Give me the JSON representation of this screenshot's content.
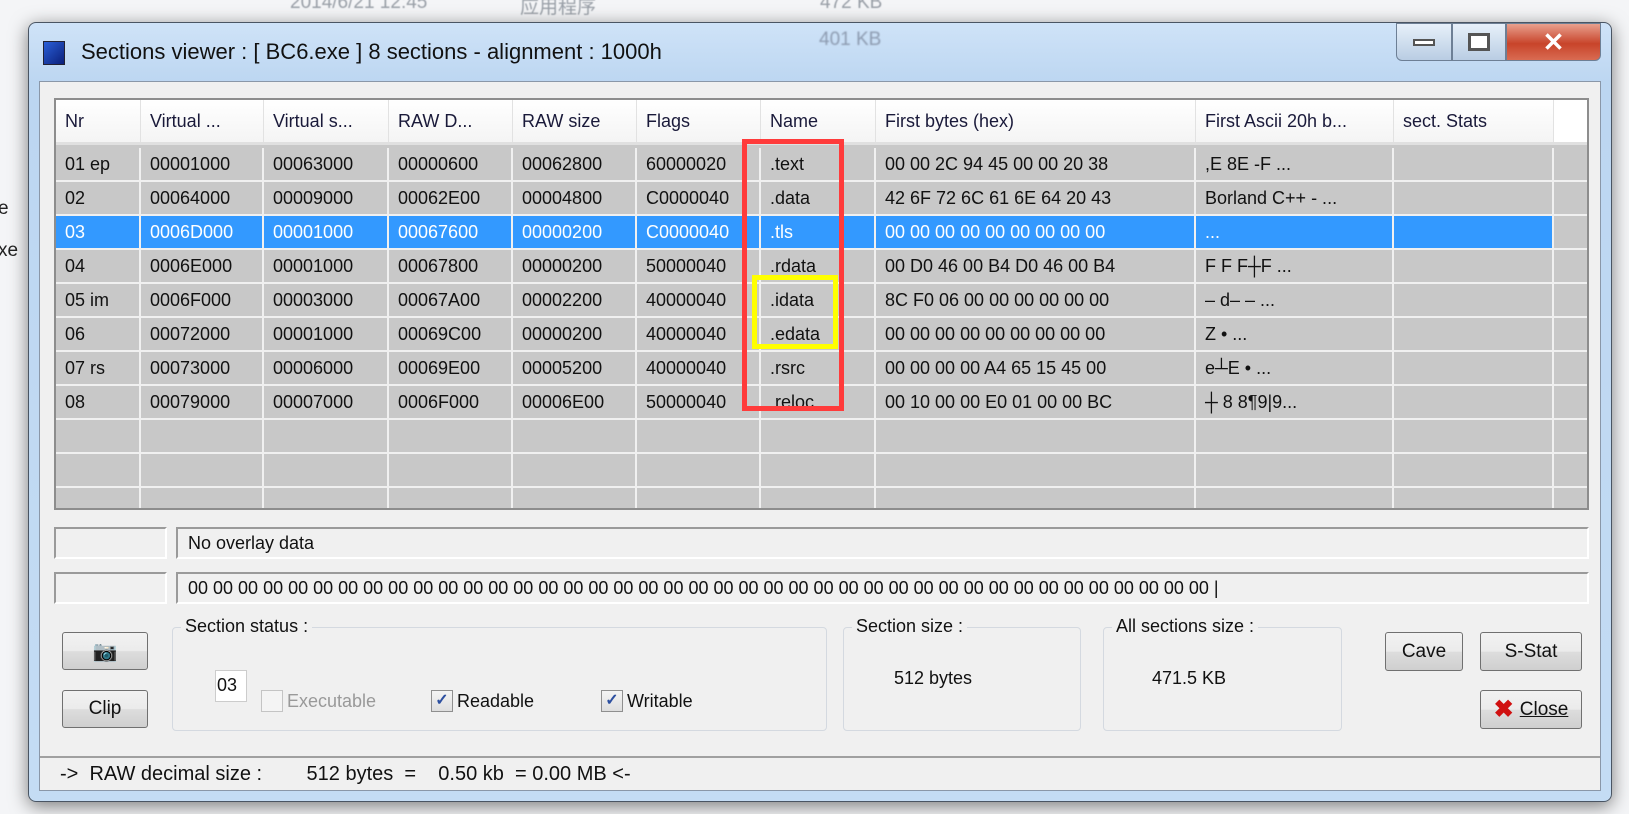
{
  "background": {
    "date": "2014/6/21 12:45",
    "type": "应用程序",
    "size": "472 KB",
    "size2": "401 KB",
    "left_frag1": "e",
    "left_frag2": "xe"
  },
  "window": {
    "title": "Sections viewer :  [ BC6.exe ] 8 sections - alignment : 1000h",
    "minimize": "—",
    "maximize": "□",
    "close": "✕"
  },
  "table": {
    "columns": [
      "Nr",
      "Virtual ...",
      "Virtual s...",
      "RAW D...",
      "RAW size",
      "Flags",
      "Name",
      "First bytes (hex)",
      "First Ascii 20h b...",
      "sect. Stats"
    ],
    "selected_row": 2,
    "rows": [
      [
        "01 ep",
        "00001000",
        "00063000",
        "00000600",
        "00062800",
        "60000020",
        ".text",
        "00 00 2C 94 45 00 00 20 38",
        " ,E  8E  -F   ...",
        ""
      ],
      [
        "02",
        "00064000",
        "00009000",
        "00062E00",
        "00004800",
        "C0000040",
        ".data",
        "42 6F 72 6C 61 6E 64 20 43",
        "Borland C++ - ...",
        ""
      ],
      [
        "03",
        "0006D000",
        "00001000",
        "00067600",
        "00000200",
        "C0000040",
        ".tls",
        "00 00 00 00 00 00 00 00 00",
        "                  ...",
        ""
      ],
      [
        "04",
        "0006E000",
        "00001000",
        "00067800",
        "00000200",
        "50000040",
        ".rdata",
        "00 D0 46 00 B4 D0 46 00 B4",
        "  F  F  F┼F    ...",
        ""
      ],
      [
        "05 im",
        "0006F000",
        "00003000",
        "00067A00",
        "00002200",
        "40000040",
        ".idata",
        "8C F0 06 00 00 00 00 00 00",
        "  –       d–  – ...",
        ""
      ],
      [
        "06",
        "00072000",
        "00001000",
        "00069C00",
        "00000200",
        "40000040",
        ".edata",
        "00 00 00 00 00 00 00 00 00",
        "          Z •      ...",
        ""
      ],
      [
        "07 rs",
        "00073000",
        "00006000",
        "00069E00",
        "00005200",
        "40000040",
        ".rsrc",
        "00 00 00 00 A4 65 15 45 00",
        "    e┴E     •    ...",
        ""
      ],
      [
        "08",
        "00079000",
        "00007000",
        "0006F000",
        "00006E00",
        "50000040",
        ".reloc",
        "00 10 00 00 E0 01 00 00 BC",
        " ┼         8 8¶9|9...",
        ""
      ]
    ]
  },
  "overlay": {
    "text": "No overlay data",
    "hex": "00 00 00 00 00 00 00 00 00 00 00 00 00 00 00 00 00 00 00 00 00 00 00 00 00 00 00 00 00 00 00 00 00 00 00 00 00 00 00 00 00   |"
  },
  "section_status": {
    "label": "Section status :",
    "number": "03",
    "executable": {
      "label": "Executable",
      "checked": false,
      "enabled": false
    },
    "readable": {
      "label": "Readable",
      "checked": true
    },
    "writable": {
      "label": "Writable",
      "checked": true
    }
  },
  "section_size": {
    "label": "Section size :",
    "value": "512 bytes"
  },
  "all_sections_size": {
    "label": "All sections size :",
    "value": "471.5 KB"
  },
  "buttons": {
    "camera_icon": "camera-icon",
    "clip": "Clip",
    "cave": "Cave",
    "sstat": "S-Stat",
    "close": "Close"
  },
  "statusbar": {
    "text": "->  RAW decimal size :        512 bytes  =    0.50 kb  = 0.00 MB <-"
  },
  "colors": {
    "selection": "#3399ff",
    "red_highlight": "#ff3b3b",
    "yellow_highlight": "#ffff00",
    "grid_bg": "#c8c8c8"
  }
}
